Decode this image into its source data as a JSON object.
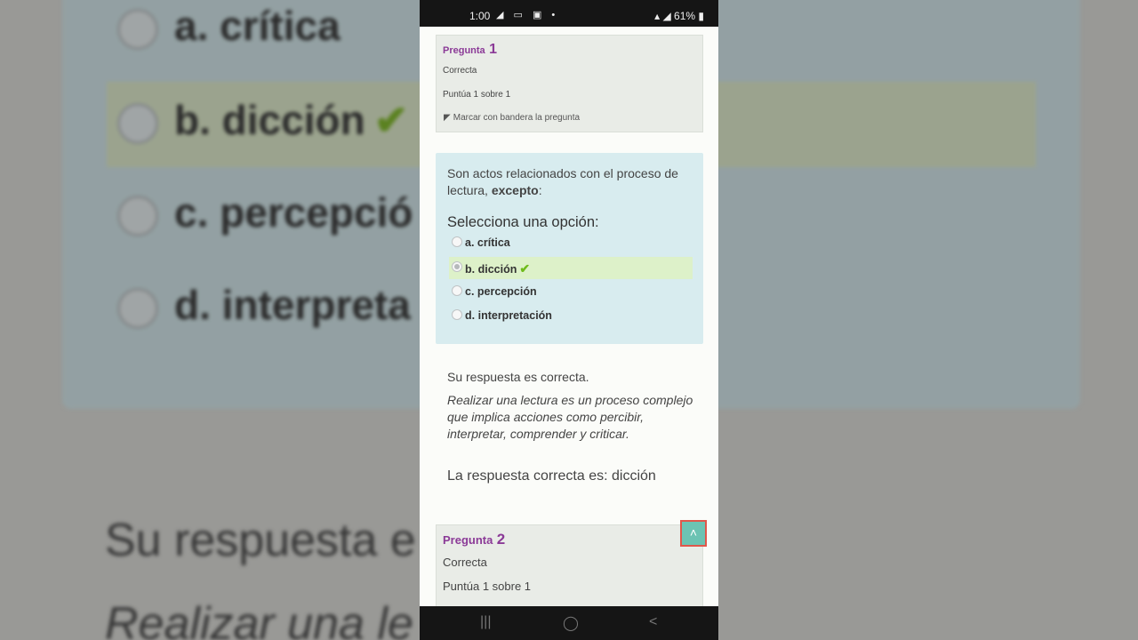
{
  "status_bar": {
    "time": "1:00",
    "left_icons": "◢ ▭ ▣ •",
    "battery": "61%"
  },
  "question1": {
    "label": "Pregunta",
    "number": "1",
    "state": "Correcta",
    "score": "Puntúa 1 sobre 1",
    "flag_label": "Marcar con bandera la pregunta",
    "stem_before": "Son actos relacionados con el proceso de lectura, ",
    "stem_bold": "excepto",
    "stem_after": ":",
    "prompt": "Selecciona una opción:",
    "options": [
      {
        "letter": "a.",
        "text": "crítica",
        "selected": false
      },
      {
        "letter": "b.",
        "text": "dicción",
        "selected": true
      },
      {
        "letter": "c.",
        "text": "percepción",
        "selected": false
      },
      {
        "letter": "d.",
        "text": "interpretación",
        "selected": false
      }
    ],
    "feedback_status": "Su respuesta es correcta.",
    "feedback_explanation": "Realizar una lectura es un proceso complejo que implica acciones como percibir, interpretar, comprender y criticar.",
    "correct_answer": "La respuesta correcta es: dicción"
  },
  "question2": {
    "label": "Pregunta",
    "number": "2",
    "state": "Correcta",
    "score": "Puntúa 1 sobre 1"
  },
  "background_zoom": {
    "opt_a": "a. crítica",
    "opt_b": "b. dicción",
    "opt_c": "c. percepció",
    "opt_d": "d. interpreta",
    "resp": "Su respuesta e",
    "expl": "Realizar una le          proceso"
  },
  "back_to_top_label": "˄",
  "colors": {
    "accent_purple": "#8b3a97",
    "question_bg": "#d8ecef",
    "correct_bg": "#ddf1c9",
    "back_to_top": "#6cc3b3"
  }
}
